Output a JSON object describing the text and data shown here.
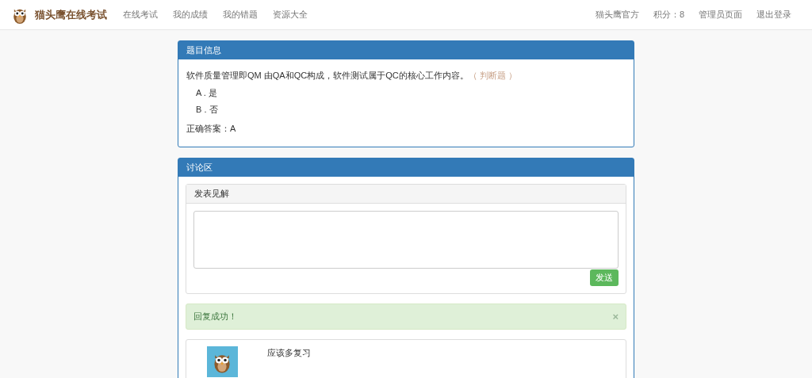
{
  "navbar": {
    "brand": "猫头鹰在线考试",
    "links": [
      {
        "label": "在线考试"
      },
      {
        "label": "我的成绩"
      },
      {
        "label": "我的错题"
      },
      {
        "label": "资源大全"
      }
    ],
    "right_links": [
      {
        "label": "猫头鹰官方"
      },
      {
        "label": "积分：8"
      },
      {
        "label": "管理员页面"
      },
      {
        "label": "退出登录"
      }
    ]
  },
  "question_panel": {
    "title": "题目信息",
    "question": "软件质量管理即QM 由QA和QC构成，软件测试属于QC的核心工作内容。",
    "question_type": "（ 判断题 ）",
    "options": [
      "A . 是",
      "B . 否"
    ],
    "answer": "正确答案：A"
  },
  "discussion_panel": {
    "title": "讨论区",
    "composer": {
      "title": "发表见解",
      "send_button": "发送"
    },
    "alert": {
      "message": "回复成功！",
      "close": "×"
    },
    "comments": [
      {
        "text": "应该多复习"
      }
    ]
  }
}
